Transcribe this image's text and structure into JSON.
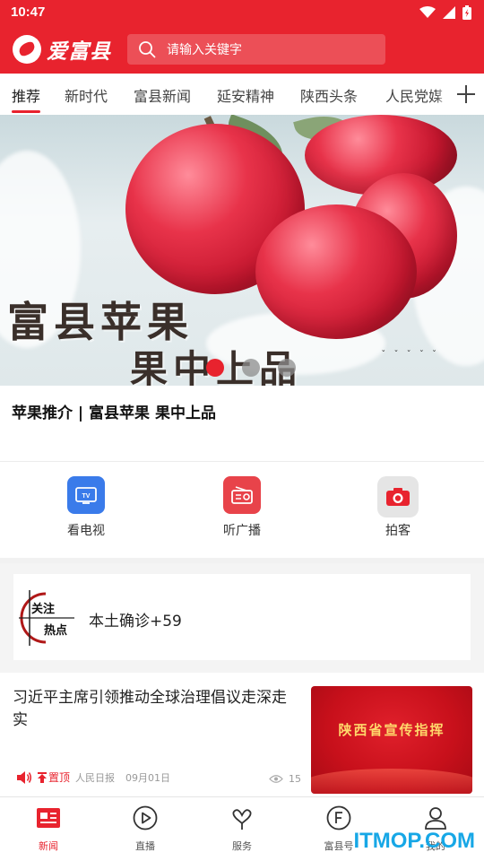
{
  "status_bar": {
    "time": "10:47"
  },
  "header": {
    "app_name": "爱富县",
    "search_placeholder": "请输入关键字"
  },
  "tabs": [
    {
      "label": "推荐",
      "active": true
    },
    {
      "label": "新时代"
    },
    {
      "label": "富县新闻"
    },
    {
      "label": "延安精神"
    },
    {
      "label": "陕西头条"
    },
    {
      "label": "人民党媒"
    }
  ],
  "banner": {
    "overlay_line1": "富县苹果",
    "overlay_line2": "果中上品",
    "slide_count": 3,
    "active_slide": 1,
    "caption": "苹果推介 | 富县苹果 果中上品"
  },
  "services": [
    {
      "label": "看电视",
      "icon": "tv-icon",
      "color": "#3a7bea"
    },
    {
      "label": "听广播",
      "icon": "radio-icon",
      "color": "#e8434a"
    },
    {
      "label": "拍客",
      "icon": "camera-icon",
      "color": "#e8232e"
    }
  ],
  "hot_topic": {
    "logo_line1": "关注",
    "logo_line2": "热点",
    "text": "本土确诊+59"
  },
  "news_item": {
    "title": "习近平主席引领推动全球治理倡议走深走实",
    "image_text": "陕西省宣传指挥",
    "pin_label": "置顶",
    "source": "人民日报",
    "date": "09月01日",
    "views": "15"
  },
  "bottom_nav": [
    {
      "label": "新闻",
      "icon": "news-icon",
      "active": true
    },
    {
      "label": "直播",
      "icon": "live-play-icon"
    },
    {
      "label": "服务",
      "icon": "service-icon"
    },
    {
      "label": "富县号",
      "icon": "fuxian-hao-icon"
    },
    {
      "label": "我的",
      "icon": "profile-icon"
    }
  ],
  "watermark": "ITMOP.COM",
  "colors": {
    "brand_red": "#e8232e",
    "tv_blue": "#3a7bea"
  }
}
